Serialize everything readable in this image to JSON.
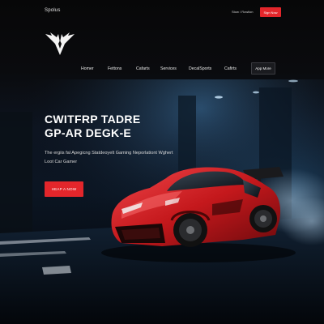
{
  "header": {
    "brand": "Spolus",
    "account_link": "Stow / Rowlion",
    "cta": "Sign Now"
  },
  "nav": {
    "items": [
      "Homer",
      "Fettons",
      "Cafarts",
      "Services",
      "DecalSports",
      "Cafirts"
    ],
    "cta": "App More"
  },
  "hero": {
    "title_line1": "CWITFRP TADRE",
    "title_line2": "GP-AR DEGK-E",
    "subtitle": "The ergiis fal Apegicng Statdeoyelt Gaming Neporlationt Wghert Loot Car Gamer",
    "cta": "HEAP A NOW"
  },
  "colors": {
    "accent": "#e3262b",
    "car_red": "#c4181c",
    "background": "#050506",
    "scene_blue": "#16304a"
  },
  "icons": {
    "logo": "winged-emblem-icon"
  }
}
